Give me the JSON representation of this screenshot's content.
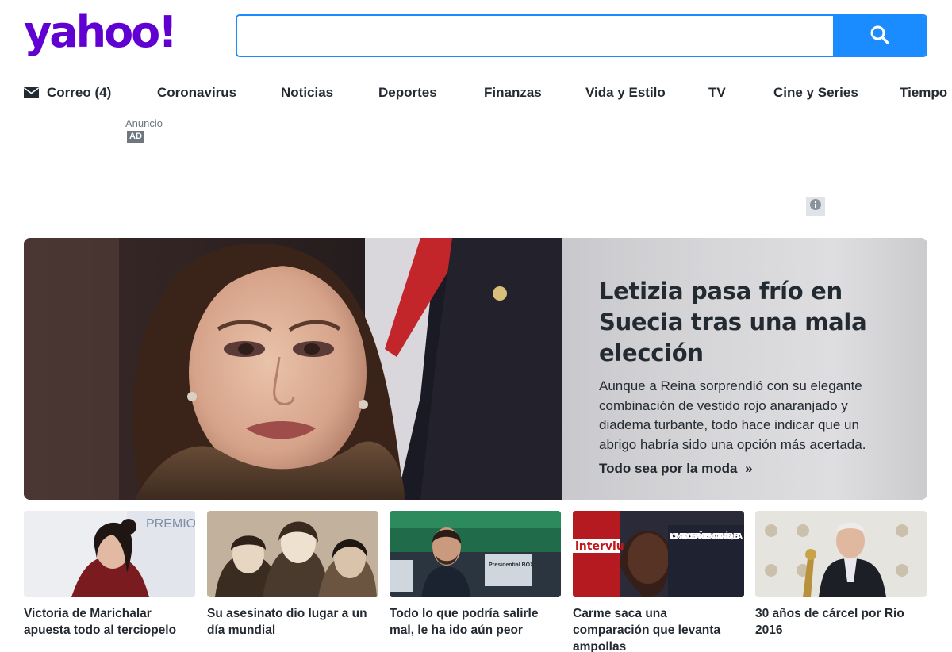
{
  "header": {
    "logo_text": "yahoo!",
    "search": {
      "value": "",
      "placeholder": ""
    },
    "search_button_icon": "search-icon"
  },
  "nav": {
    "items": [
      {
        "label": "Correo (4)",
        "icon": "mail-icon"
      },
      {
        "label": "Coronavirus"
      },
      {
        "label": "Noticias"
      },
      {
        "label": "Deportes"
      },
      {
        "label": "Finanzas"
      },
      {
        "label": "Vida y Estilo"
      },
      {
        "label": "TV"
      },
      {
        "label": "Cine y Series"
      },
      {
        "label": "Tiempo"
      }
    ]
  },
  "ad": {
    "label": "Anuncio",
    "badge": "AD",
    "info_icon": "info-icon"
  },
  "hero": {
    "title": "Letizia pasa frío en Suecia tras una mala elección",
    "summary": "Aunque a Reina sorprendió con su elegante combinación de vestido rojo anaranjado y diadema turbante, todo hace indicar que un abrigo habría sido una opción más acertada.",
    "link_label": "Todo sea por la moda",
    "link_arrow": "»"
  },
  "stories": [
    {
      "title": "Victoria de Marichalar apuesta todo al terciopelo",
      "thumb_text": "PREMIO"
    },
    {
      "title": "Su asesinato dio lugar a un día mundial"
    },
    {
      "title": "Todo lo que podría salirle mal, le ha ido aún peor",
      "thumb_text": "Presidential BOX"
    },
    {
      "title": "Carme saca una comparación que levanta ampollas",
      "thumb_text": "LOS MARIDOS ESPAÑOLES MATAN MÁS QUE ETA",
      "thumb_brand": "interviu"
    },
    {
      "title": "30 años de cárcel por Rio 2016"
    }
  ],
  "colors": {
    "brand": "#6001d2",
    "search_blue": "#1a8cff",
    "text": "#232a31"
  }
}
